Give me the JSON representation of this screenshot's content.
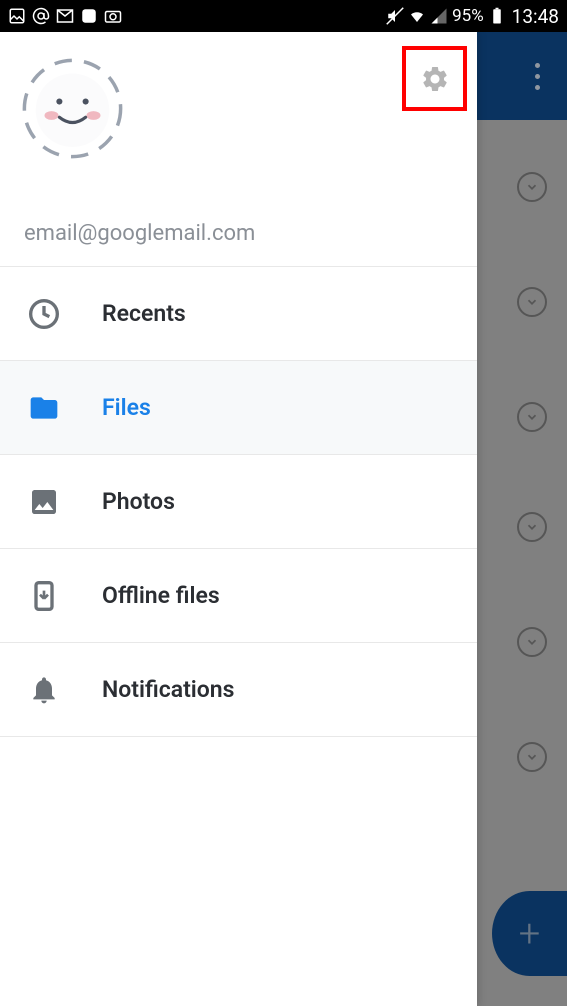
{
  "status_bar": {
    "battery_pct": "95%",
    "time": "13:48"
  },
  "drawer": {
    "email": "email@googlemail.com",
    "nav": [
      {
        "id": "recents",
        "label": "Recents",
        "active": false
      },
      {
        "id": "files",
        "label": "Files",
        "active": true
      },
      {
        "id": "photos",
        "label": "Photos",
        "active": false
      },
      {
        "id": "offline",
        "label": "Offline files",
        "active": false
      },
      {
        "id": "notifications",
        "label": "Notifications",
        "active": false
      }
    ]
  }
}
